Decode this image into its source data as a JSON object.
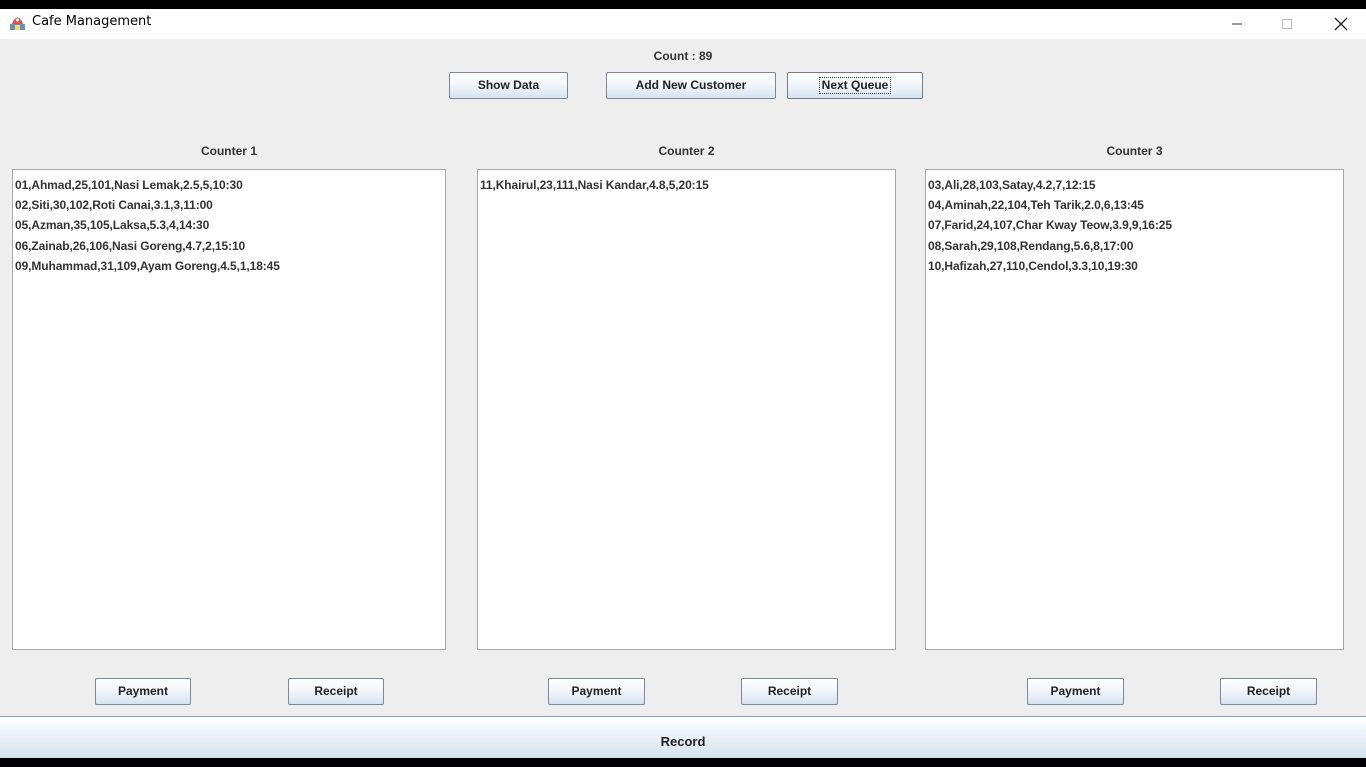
{
  "window": {
    "title": "Cafe Management",
    "controls": {
      "minimize": "–",
      "maximize": "☐",
      "close": "✕"
    }
  },
  "header": {
    "count": "Count : 89",
    "buttons": {
      "show_data": "Show Data",
      "add_customer": "Add New Customer",
      "next_queue": "Next Queue"
    }
  },
  "counters": [
    {
      "title": "Counter 1",
      "rows": [
        "01,Ahmad,25,101,Nasi Lemak,2.5,5,10:30",
        "02,Siti,30,102,Roti Canai,3.1,3,11:00",
        "05,Azman,35,105,Laksa,5.3,4,14:30",
        "06,Zainab,26,106,Nasi Goreng,4.7,2,15:10",
        "09,Muhammad,31,109,Ayam Goreng,4.5,1,18:45"
      ],
      "payment_label": "Payment",
      "receipt_label": "Receipt"
    },
    {
      "title": "Counter 2",
      "rows": [
        "11,Khairul,23,111,Nasi Kandar,4.8,5,20:15"
      ],
      "payment_label": "Payment",
      "receipt_label": "Receipt"
    },
    {
      "title": "Counter 3",
      "rows": [
        "03,Ali,28,103,Satay,4.2,7,12:15",
        "04,Aminah,22,104,Teh Tarik,2.0,6,13:45",
        "07,Farid,24,107,Char Kway Teow,3.9,9,16:25",
        "08,Sarah,29,108,Rendang,5.6,8,17:00",
        "10,Hafizah,27,110,Cendol,3.3,10,19:30"
      ],
      "payment_label": "Payment",
      "receipt_label": "Receipt"
    }
  ],
  "footer": {
    "record_label": "Record"
  },
  "icons": {
    "app": "java-app-icon"
  }
}
